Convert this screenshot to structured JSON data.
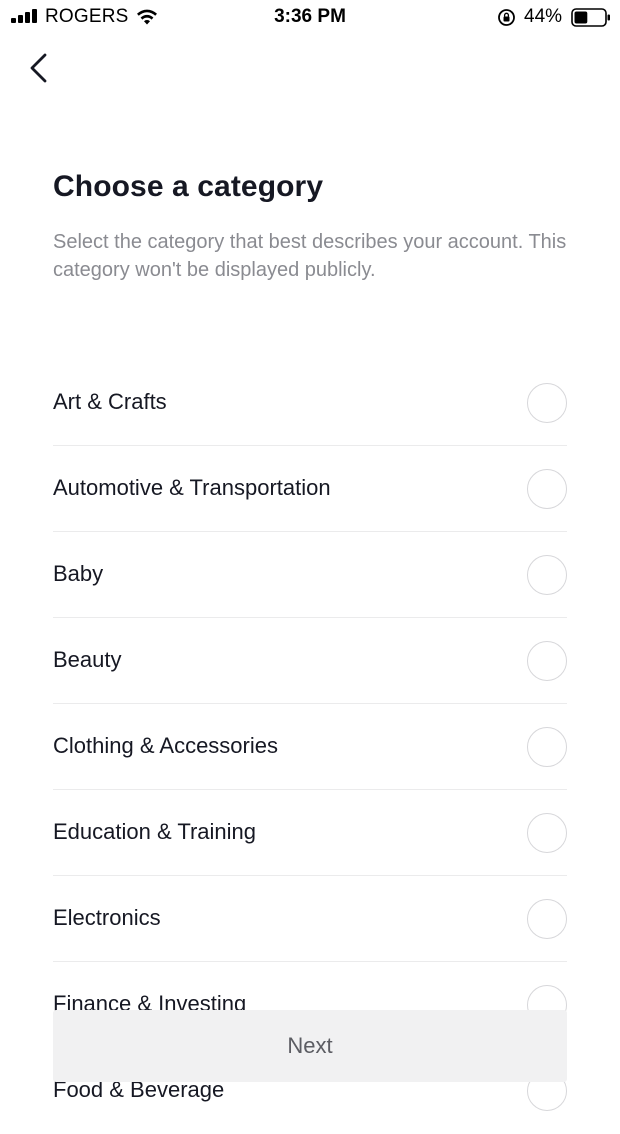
{
  "status_bar": {
    "carrier": "ROGERS",
    "time": "3:36 PM",
    "battery": "44%",
    "battery_level": 0.44,
    "icons": [
      "signal-icon",
      "wifi-icon",
      "rotation-lock-icon",
      "battery-icon"
    ]
  },
  "nav": {
    "back_icon": "chevron-left-icon"
  },
  "header": {
    "title": "Choose a category",
    "subtitle": "Select the category that best describes your account. This category won't be displayed publicly."
  },
  "categories": [
    {
      "label": "Art & Crafts",
      "selected": false
    },
    {
      "label": "Automotive & Transportation",
      "selected": false
    },
    {
      "label": "Baby",
      "selected": false
    },
    {
      "label": "Beauty",
      "selected": false
    },
    {
      "label": "Clothing & Accessories",
      "selected": false
    },
    {
      "label": "Education & Training",
      "selected": false
    },
    {
      "label": "Electronics",
      "selected": false
    },
    {
      "label": "Finance & Investing",
      "selected": false
    },
    {
      "label": "Food & Beverage",
      "selected": false
    }
  ],
  "footer": {
    "next_label": "Next"
  },
  "colors": {
    "text_primary": "#161823",
    "text_secondary": "#8a8b91",
    "divider": "#ebebec",
    "radio_border": "#d7d7da",
    "button_bg": "#f1f1f2",
    "button_text": "#5c5d63"
  }
}
